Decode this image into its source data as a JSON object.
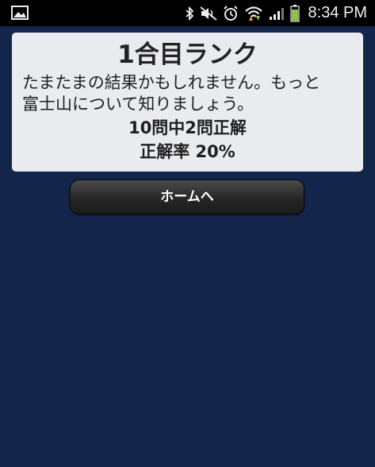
{
  "status_bar": {
    "time": "8:34 PM",
    "icons": [
      "gallery-icon",
      "bluetooth-icon",
      "mute-icon",
      "alarm-icon",
      "wifi-icon",
      "signal-icon",
      "battery-icon"
    ],
    "battery_color": "#8bc34a"
  },
  "result": {
    "rank_title": "1合目ランク",
    "message_line1": "たまたまの結果かもしれません。もっと",
    "message_line2": "富士山について知りましょう。",
    "correct_summary": "10問中2問正解",
    "accuracy": "正解率 20%"
  },
  "home_button": {
    "label": "ホームへ"
  },
  "colors": {
    "background": "#13254b",
    "card": "#eaebee",
    "button": "#2a2a2a"
  }
}
